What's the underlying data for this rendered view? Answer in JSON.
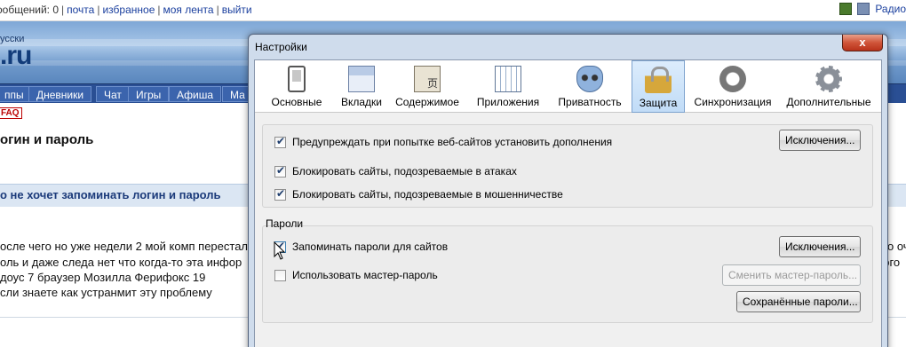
{
  "page": {
    "topbar": {
      "links": [
        "ообщений: 0",
        "почта",
        "избранное",
        "моя лента",
        "выйти"
      ],
      "right_text": "Радио"
    },
    "logo": {
      "small": "усски",
      "big": ".ru"
    },
    "nav": [
      "ппы",
      "Дневники",
      "Чат",
      "Игры",
      "Афиша",
      "Ма"
    ],
    "faq": "FAQ",
    "title": "огин и пароль",
    "topic": "о не хочет запоминать логин и пароль",
    "post_lines": [
      "осле чего но уже недели 2 мой комп перестал",
      "оль и даже следа нет что когда-то эта инфор",
      "доус 7 браузер Мозилла Ферифокс 19",
      "сли знаете как устранмит эту проблему"
    ],
    "post_right": [
      "о оч",
      "рого"
    ]
  },
  "dialog": {
    "title": "Настройки",
    "close": "x",
    "tabs": [
      {
        "label": "Основные",
        "icon": "general-icon"
      },
      {
        "label": "Вкладки",
        "icon": "tabs-icon"
      },
      {
        "label": "Содержимое",
        "icon": "content-icon"
      },
      {
        "label": "Приложения",
        "icon": "applications-icon"
      },
      {
        "label": "Приватность",
        "icon": "privacy-mask-icon"
      },
      {
        "label": "Защита",
        "icon": "padlock-icon",
        "selected": true
      },
      {
        "label": "Синхронизация",
        "icon": "sync-icon"
      },
      {
        "label": "Дополнительные",
        "icon": "gear-icon"
      }
    ],
    "security": {
      "warn_addons": "Предупреждать при попытке веб-сайтов установить дополнения",
      "block_attack": "Блокировать сайты, подозреваемые в атаках",
      "block_forgery": "Блокировать сайты, подозреваемые в мошенничестве",
      "exceptions_1": "Исключения..."
    },
    "passwords": {
      "legend": "Пароли",
      "remember": "Запоминать пароли для сайтов",
      "master": "Использовать мастер-пароль",
      "exceptions_2": "Исключения...",
      "change_master": "Сменить мастер-пароль...",
      "saved": "Сохранённые пароли..."
    }
  }
}
